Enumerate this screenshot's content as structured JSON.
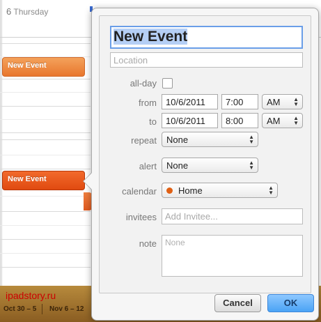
{
  "calendar": {
    "day_number": "6",
    "day_name": "Thursday",
    "events": [
      "New Event",
      "New Event"
    ],
    "watermark": "ipadstory.ru",
    "weeks": [
      "Oct 30 – 5",
      "Nov 6 – 12"
    ]
  },
  "popover": {
    "title_value": "New Event",
    "location_placeholder": "Location",
    "labels": {
      "all_day": "all-day",
      "from": "from",
      "to": "to",
      "repeat": "repeat",
      "alert": "alert",
      "calendar": "calendar",
      "invitees": "invitees",
      "note": "note"
    },
    "all_day_checked": false,
    "from": {
      "date": "10/6/2011",
      "time": "7:00",
      "ampm": "AM"
    },
    "to": {
      "date": "10/6/2011",
      "time": "8:00",
      "ampm": "AM"
    },
    "repeat_value": "None",
    "alert_value": "None",
    "calendar_value": "Home",
    "calendar_color": "#e06014",
    "invitees_placeholder": "Add Invitee...",
    "note_placeholder": "None",
    "cancel_label": "Cancel",
    "ok_label": "OK"
  },
  "icons": {
    "select_chevron": "updown-chevron-icon",
    "calendar_dot": "calendar-color-dot-icon"
  }
}
